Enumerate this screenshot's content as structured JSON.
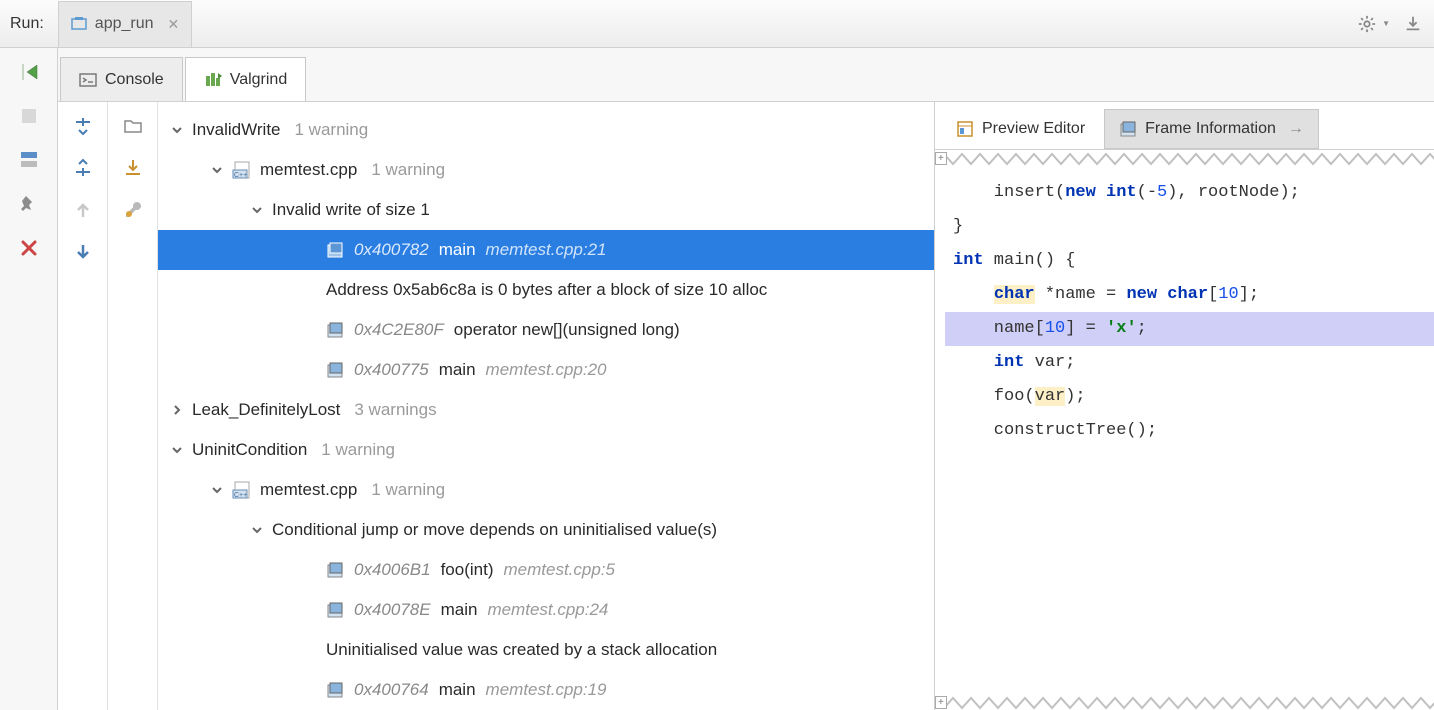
{
  "header": {
    "run_label": "Run:",
    "tab_title": "app_run"
  },
  "subtabs": {
    "console": "Console",
    "valgrind": "Valgrind"
  },
  "right_tabs": {
    "preview": "Preview Editor",
    "frame_info": "Frame Information"
  },
  "tree": {
    "invalid_write": {
      "label": "InvalidWrite",
      "meta": "1 warning",
      "file": "memtest.cpp",
      "file_meta": "1 warning",
      "msg": "Invalid write of size 1",
      "frame_sel": {
        "addr": "0x400782",
        "fn": "main",
        "loc": "memtest.cpp:21"
      },
      "note": "Address 0x5ab6c8a is 0 bytes after a block of size 10 alloc",
      "frame_a": {
        "addr": "0x4C2E80F",
        "fn": "operator new[](unsigned long)"
      },
      "frame_b": {
        "addr": "0x400775",
        "fn": "main",
        "loc": "memtest.cpp:20"
      }
    },
    "leak": {
      "label": "Leak_DefinitelyLost",
      "meta": "3 warnings"
    },
    "uninit": {
      "label": "UninitCondition",
      "meta": "1 warning",
      "file": "memtest.cpp",
      "file_meta": "1 warning",
      "msg": "Conditional jump or move depends on uninitialised value(s)",
      "frame_a": {
        "addr": "0x4006B1",
        "fn": "foo(int)",
        "loc": "memtest.cpp:5"
      },
      "frame_b": {
        "addr": "0x40078E",
        "fn": "main",
        "loc": "memtest.cpp:24"
      },
      "note": "Uninitialised value was created by a stack allocation",
      "frame_c": {
        "addr": "0x400764",
        "fn": "main",
        "loc": "memtest.cpp:19"
      }
    }
  },
  "code": {
    "l1": "    insert(new int(-5), rootNode);",
    "l2": "}",
    "l3": "",
    "l4_a": "int",
    "l4_b": " main() {",
    "l5_a": "    ",
    "l5_b": "char",
    "l5_c": " *name = ",
    "l5_d": "new",
    "l5_e": " ",
    "l5_f": "char",
    "l5_g": "[",
    "l5_h": "10",
    "l5_i": "];",
    "l6_a": "    name[",
    "l6_b": "10",
    "l6_c": "] = ",
    "l6_d": "'x'",
    "l6_e": ";",
    "l7": "",
    "l8_a": "    ",
    "l8_b": "int",
    "l8_c": " var;",
    "l9_a": "    foo(",
    "l9_b": "var",
    "l9_c": ");",
    "l10": "    constructTree();"
  }
}
